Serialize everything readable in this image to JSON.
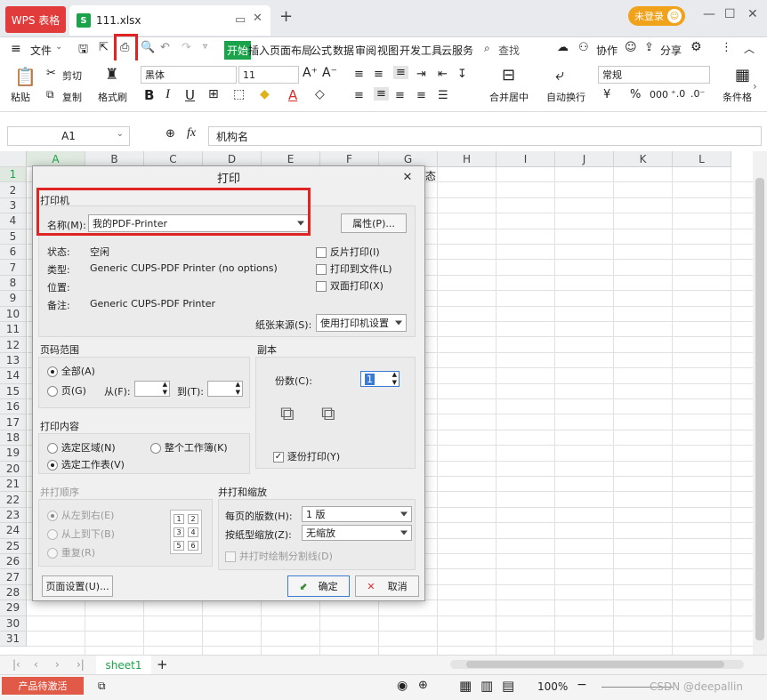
{
  "tabs": {
    "app_label": "WPS 表格",
    "file_name": "111.xlsx",
    "new_tab": "+",
    "login_label": "未登录"
  },
  "menu": {
    "file": "文件",
    "items": [
      "开始",
      "插入",
      "页面布局",
      "公式",
      "数据",
      "审阅",
      "视图",
      "开发工具",
      "云服务"
    ],
    "search": "查找",
    "collab": "协作",
    "share": "分享"
  },
  "ribbon": {
    "paste": "粘贴",
    "cut": "剪切",
    "copy": "复制",
    "format_painter": "格式刷",
    "font_name": "黑体",
    "font_size": "11",
    "merge": "合并居中",
    "wrap": "自动换行",
    "number_format": "常规",
    "cond_format": "条件格",
    "currency_symbol": "¥",
    "percent": "%",
    "thousands": "000",
    "bold": "B",
    "italic": "I",
    "underline": "U",
    "font_color_glyph": "A"
  },
  "formula_bar": {
    "cell_ref": "A1",
    "fx": "fx",
    "content": "机构名"
  },
  "grid": {
    "columns": [
      "A",
      "B",
      "C",
      "D",
      "E",
      "F",
      "G",
      "H",
      "I",
      "J",
      "K",
      "L"
    ],
    "rows": [
      "1",
      "2",
      "3",
      "4",
      "5",
      "6",
      "7",
      "8",
      "9",
      "10",
      "11",
      "12",
      "13",
      "14",
      "15",
      "16",
      "17",
      "18",
      "19",
      "20",
      "21",
      "22",
      "23",
      "24",
      "25",
      "26",
      "27",
      "28",
      "29",
      "30",
      "31"
    ],
    "g1_partial": "态"
  },
  "dialog": {
    "title": "打印",
    "printer_group": "打印机",
    "name_label": "名称(M):",
    "printer_name": "我的PDF-Printer",
    "properties_btn": "属性(P)...",
    "status_label": "状态:",
    "status_value": "空闲",
    "type_label": "类型:",
    "type_value": "Generic CUPS-PDF Printer (no options)",
    "location_label": "位置:",
    "location_value": "",
    "comment_label": "备注:",
    "comment_value": "Generic CUPS-PDF Printer",
    "reverse_print": "反片打印(I)",
    "print_to_file": "打印到文件(L)",
    "duplex": "双面打印(X)",
    "paper_source_label": "纸张来源(S):",
    "paper_source_value": "使用打印机设置",
    "range_group": "页码范围",
    "range_all": "全部(A)",
    "range_pages": "页(G)",
    "range_from": "从(F):",
    "range_to": "到(T):",
    "copies_group": "副本",
    "copies_label": "份数(C):",
    "copies_value": "1",
    "collate": "逐份打印(Y)",
    "content_group": "打印内容",
    "content_selection": "选定区域(N)",
    "content_workbook": "整个工作簿(K)",
    "content_sheet": "选定工作表(V)",
    "order_group": "并打顺序",
    "order_lr": "从左到右(E)",
    "order_tb": "从上到下(B)",
    "order_repeat": "重复(R)",
    "order_thumb": [
      "1",
      "2",
      "3",
      "4",
      "5",
      "6"
    ],
    "scale_group": "并打和缩放",
    "pages_per_sheet_label": "每页的版数(H):",
    "pages_per_sheet_value": "1 版",
    "scale_label": "按纸型缩放(Z):",
    "scale_value": "无缩放",
    "draw_dividers": "并打时绘制分割线(D)",
    "page_setup_btn": "页面设置(U)...",
    "ok_btn": "确定",
    "cancel_btn": "取消"
  },
  "sheetbar": {
    "sheet_name": "sheet1",
    "add": "+"
  },
  "statusbar": {
    "activate": "产品待激活",
    "zoom": "100%",
    "watermark": "CSDN @deepallin"
  },
  "colors": {
    "accent_green": "#1aa34a",
    "wps_red": "#e23b3b",
    "highlight_red": "#e02323",
    "login_orange": "#f0a21b"
  }
}
